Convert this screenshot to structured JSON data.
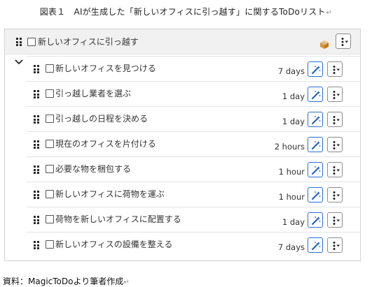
{
  "caption": {
    "title": "図表１　AIが生成した「新しいオフィスに引っ越す」に関するToDoリスト",
    "return_mark": "↵"
  },
  "parent_task": {
    "label": "新しいオフィスに引っ越す",
    "icon": "package-box-icon"
  },
  "subtasks": [
    {
      "label": "新しいオフィスを見つける",
      "duration": "7 days"
    },
    {
      "label": "引っ越し業者を選ぶ",
      "duration": "1 day"
    },
    {
      "label": "引っ越しの日程を決める",
      "duration": "1 day"
    },
    {
      "label": "現在のオフィスを片付ける",
      "duration": "2 hours"
    },
    {
      "label": "必要な物を梱包する",
      "duration": "1 hour"
    },
    {
      "label": "新しいオフィスに荷物を運ぶ",
      "duration": "1 hour"
    },
    {
      "label": "荷物を新しいオフィスに配置する",
      "duration": "1 day"
    },
    {
      "label": "新しいオフィスの設備を整える",
      "duration": "7 days"
    }
  ],
  "source": {
    "text": "資料：MagicToDoより筆者作成",
    "return_mark": "↵"
  },
  "colors": {
    "accent": "#2a6fdb",
    "parent_bg": "#f1f1f1",
    "border": "#d2d2d2"
  }
}
